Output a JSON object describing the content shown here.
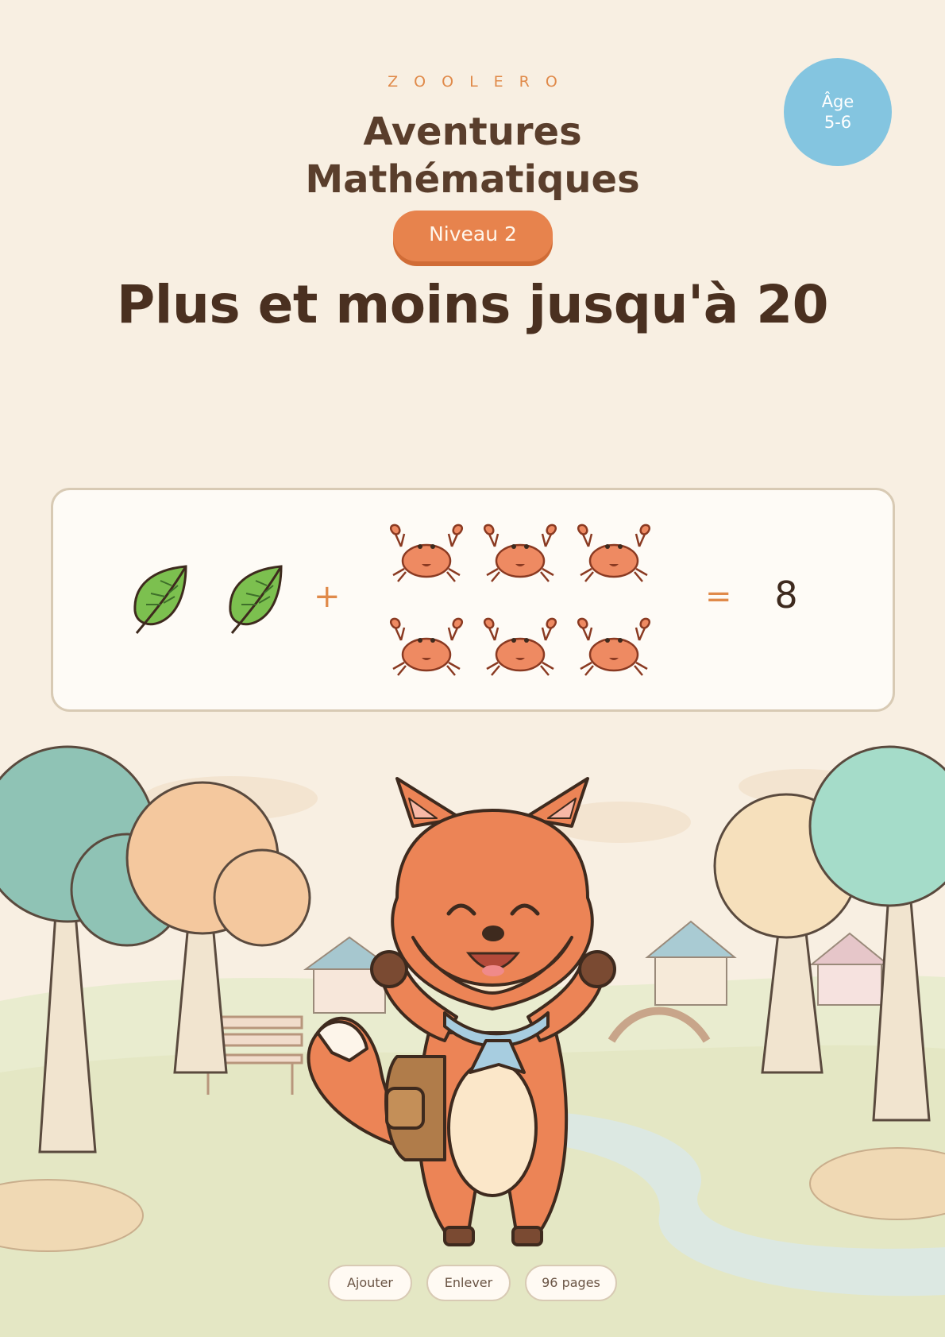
{
  "header": {
    "brand": "ZOOLERO",
    "title_line1": "Aventures",
    "title_line2": "Mathématiques",
    "level": "Niveau 2",
    "age_label": "Âge",
    "age_range": "5-6",
    "subtitle": "Plus et moins jusqu'à 20"
  },
  "equation": {
    "left_count": 2,
    "left_item": "leaf-icon",
    "operator": "+",
    "right_count": 6,
    "right_item": "crab-icon",
    "equals": "=",
    "answer": "8"
  },
  "chips": [
    "Ajouter",
    "Enlever",
    "96 pages"
  ],
  "colors": {
    "background": "#f8efe2",
    "accent": "#e7834d",
    "age_badge": "#84c5e0",
    "text_dark": "#4a3020"
  }
}
